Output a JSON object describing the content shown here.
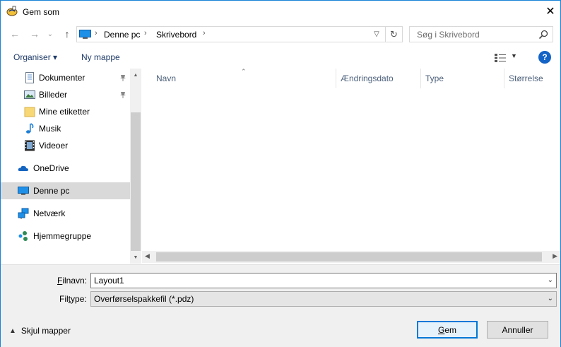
{
  "window": {
    "title": "Gem som",
    "close_glyph": "✕"
  },
  "nav": {
    "back_glyph": "←",
    "forward_glyph": "→",
    "recent_glyph": "⌄",
    "up_glyph": "↑",
    "breadcrumbs": [
      "Denne pc",
      "Skrivebord"
    ],
    "search_placeholder": "Søg i Skrivebord"
  },
  "toolbar": {
    "organize_label": "Organiser ▾",
    "new_folder_label": "Ny mappe",
    "help_label": "?"
  },
  "sidebar": {
    "items": [
      {
        "label": "Dokumenter",
        "icon": "documents-icon",
        "pinned": true
      },
      {
        "label": "Billeder",
        "icon": "pictures-icon",
        "pinned": true
      },
      {
        "label": "Mine etiketter",
        "icon": "folder-icon",
        "pinned": false
      },
      {
        "label": "Musik",
        "icon": "music-icon",
        "pinned": false
      },
      {
        "label": "Videoer",
        "icon": "videos-icon",
        "pinned": false
      },
      {
        "label": "OneDrive",
        "icon": "onedrive-icon",
        "pinned": false
      },
      {
        "label": "Denne pc",
        "icon": "this-pc-icon",
        "pinned": false,
        "selected": true
      },
      {
        "label": "Netværk",
        "icon": "network-icon",
        "pinned": false
      },
      {
        "label": "Hjemmegruppe",
        "icon": "homegroup-icon",
        "pinned": false
      }
    ]
  },
  "columns": [
    "Navn",
    "Ændringsdato",
    "Type",
    "Størrelse"
  ],
  "form": {
    "filename_label_underlined": "F",
    "filename_label_rest": "ilnavn:",
    "filename_value": "Layout1",
    "filetype_label_pre": "Fil",
    "filetype_label_underlined": "t",
    "filetype_label_rest": "ype:",
    "filetype_value": "Overførselspakkefil (*.pdz)",
    "hide_folders_label": "Skjul mapper",
    "save_underlined": "G",
    "save_rest": "em",
    "cancel_label": "Annuller"
  },
  "colors": {
    "accent": "#0078d7",
    "window_border": "#1883d7",
    "selected_bg": "#d9d9d9",
    "help_blue": "#1463c6"
  }
}
